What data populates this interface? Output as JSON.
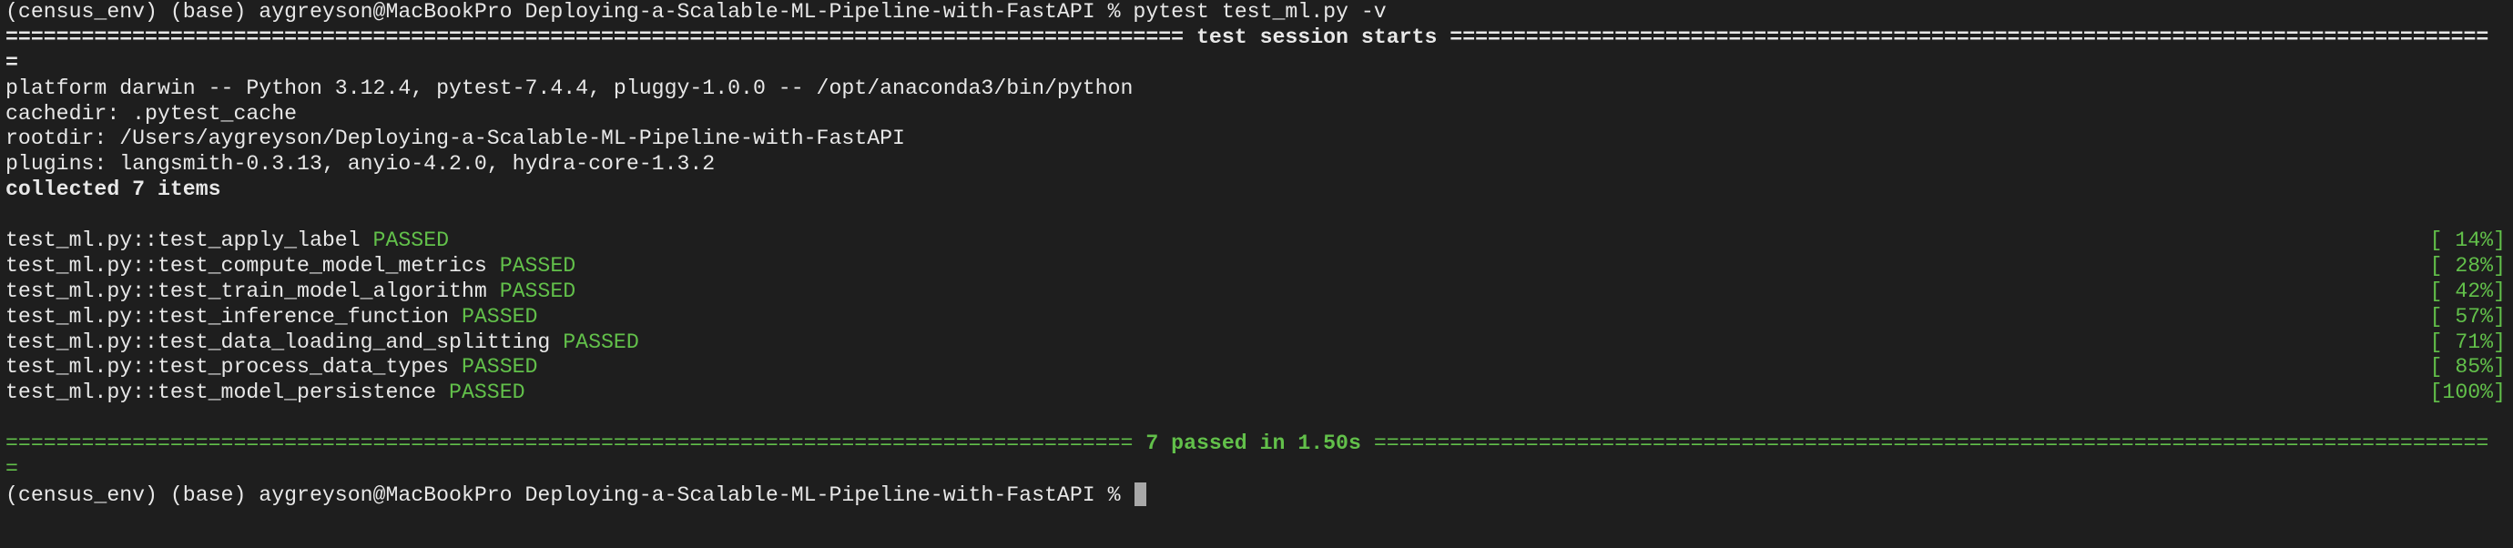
{
  "terminal": {
    "prompt": "(census_env) (base) aygreyson@MacBookPro Deploying-a-Scalable-ML-Pipeline-with-FastAPI % ",
    "command": "pytest test_ml.py -v",
    "session_header": " test session starts ",
    "platform_line": "platform darwin -- Python 3.12.4, pytest-7.4.4, pluggy-1.0.0 -- /opt/anaconda3/bin/python",
    "cachedir_line": "cachedir: .pytest_cache",
    "rootdir_line": "rootdir: /Users/aygreyson/Deploying-a-Scalable-ML-Pipeline-with-FastAPI",
    "plugins_line": "plugins: langsmith-0.3.13, anyio-4.2.0, hydra-core-1.3.2",
    "collected_line": "collected 7 items",
    "tests": [
      {
        "name": "test_ml.py::test_apply_label",
        "status": "PASSED",
        "progress": "[ 14%]"
      },
      {
        "name": "test_ml.py::test_compute_model_metrics",
        "status": "PASSED",
        "progress": "[ 28%]"
      },
      {
        "name": "test_ml.py::test_train_model_algorithm",
        "status": "PASSED",
        "progress": "[ 42%]"
      },
      {
        "name": "test_ml.py::test_inference_function",
        "status": "PASSED",
        "progress": "[ 57%]"
      },
      {
        "name": "test_ml.py::test_data_loading_and_splitting",
        "status": "PASSED",
        "progress": "[ 71%]"
      },
      {
        "name": "test_ml.py::test_process_data_types",
        "status": "PASSED",
        "progress": "[ 85%]"
      },
      {
        "name": "test_ml.py::test_model_persistence",
        "status": "PASSED",
        "progress": "[100%]"
      }
    ],
    "summary": " 7 passed in 1.50s ",
    "colors": {
      "background": "#1e1e1e",
      "text": "#e8e8e8",
      "pass": "#62c04a",
      "cursor": "#a8a8a8"
    }
  }
}
